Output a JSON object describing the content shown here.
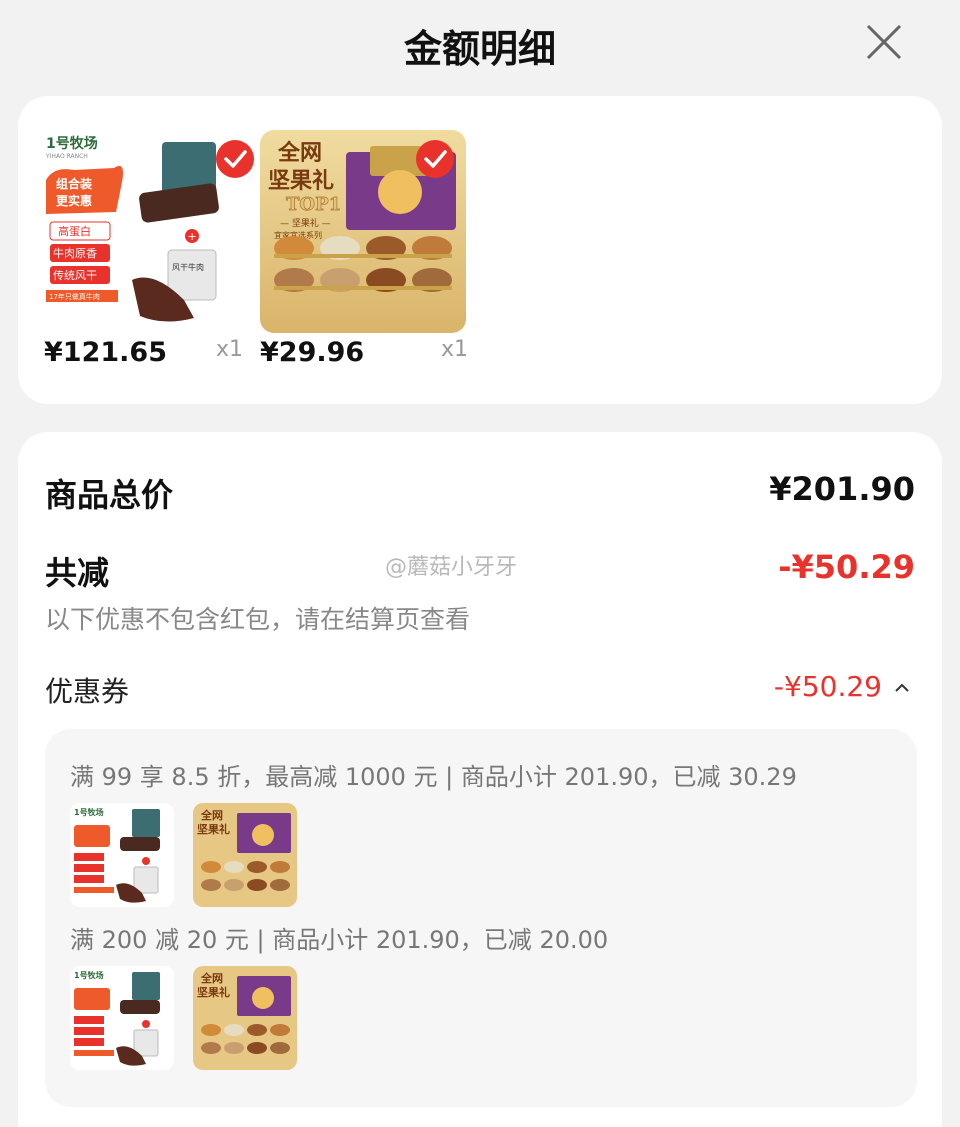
{
  "header": {
    "title": "金额明细",
    "close_icon": "close-icon"
  },
  "products": [
    {
      "price": "¥121.65",
      "qty": "x1",
      "image": "beef-jerky-combo-image",
      "selected": true,
      "brand": "1号牧场",
      "brand_en": "YIHAO RANCH",
      "promo": "组合装 更实惠",
      "tags": [
        "高蛋白",
        "牛肉原香",
        "传统风干"
      ],
      "footer": "17年只做真牛肉"
    },
    {
      "price": "¥29.96",
      "qty": "x1",
      "image": "nut-gift-box-image",
      "selected": true,
      "title": "全网 坚果礼",
      "badge": "TOP1",
      "sub": "坚果礼 · 宜家宜选系列"
    }
  ],
  "summary": {
    "total_label": "商品总价",
    "total_value": "¥201.90",
    "discount_label": "共减",
    "discount_value": "-¥50.29",
    "note": "以下优惠不包含红包，请在结算页查看"
  },
  "coupon": {
    "label": "优惠券",
    "value": "-¥50.29",
    "rules": [
      {
        "text": "满 99 享 8.5 折，最高减 1000 元 | 商品小计 201.90，已减 30.29"
      },
      {
        "text": "满 200 减 20 元 | 商品小计 201.90，已减 20.00"
      }
    ]
  },
  "watermark": "@蘑菇小牙牙",
  "colors": {
    "accent": "#e8322b",
    "background": "#f2f2f2",
    "card": "#ffffff"
  }
}
